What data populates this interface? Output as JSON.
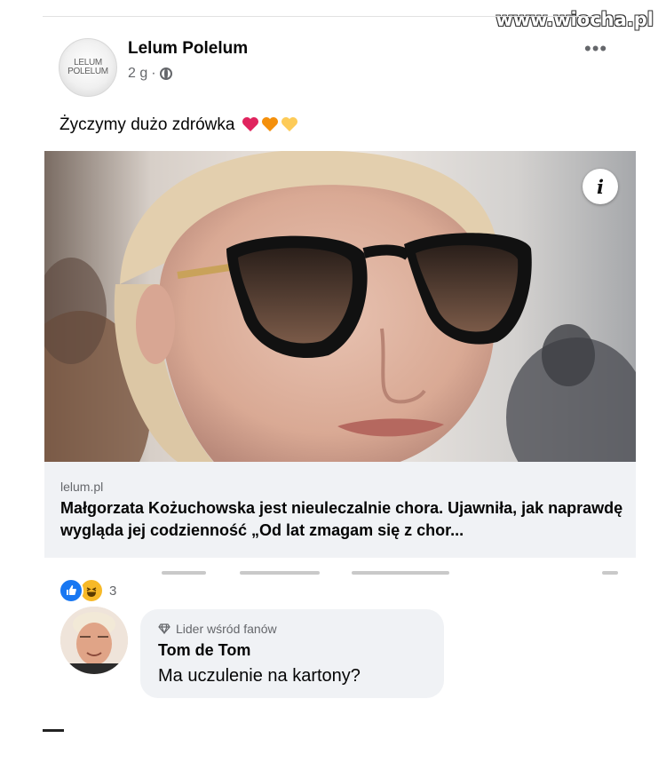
{
  "watermark": "www.wiocha.pl",
  "post": {
    "page_name": "Lelum Polelum",
    "avatar_line1": "LELUM",
    "avatar_line2": "POLELUM",
    "time": "2 g",
    "separator": "·",
    "privacy_icon": "globe-icon",
    "more_label": "•••",
    "text": "Życzymy dużo zdrówka",
    "emojis": [
      "red-heart",
      "orange-heart",
      "yellow-heart"
    ]
  },
  "link_preview": {
    "info_label": "i",
    "domain": "lelum.pl",
    "title": "Małgorzata Kożuchowska jest nieuleczalnie chora. Ujawniła, jak naprawdę wygląda jej codzienność „Od lat zmagam się z chor..."
  },
  "reactions": {
    "icons": [
      "like-icon",
      "haha-icon"
    ],
    "count": "3"
  },
  "comment": {
    "badge": "Lider wśród fanów",
    "badge_icon": "diamond-icon",
    "author": "Tom de Tom",
    "text": "Ma uczulenie na kartony?"
  },
  "colors": {
    "facebook_blue": "#1877f2",
    "bubble_bg": "#f0f2f5",
    "secondary_text": "#65676b"
  }
}
